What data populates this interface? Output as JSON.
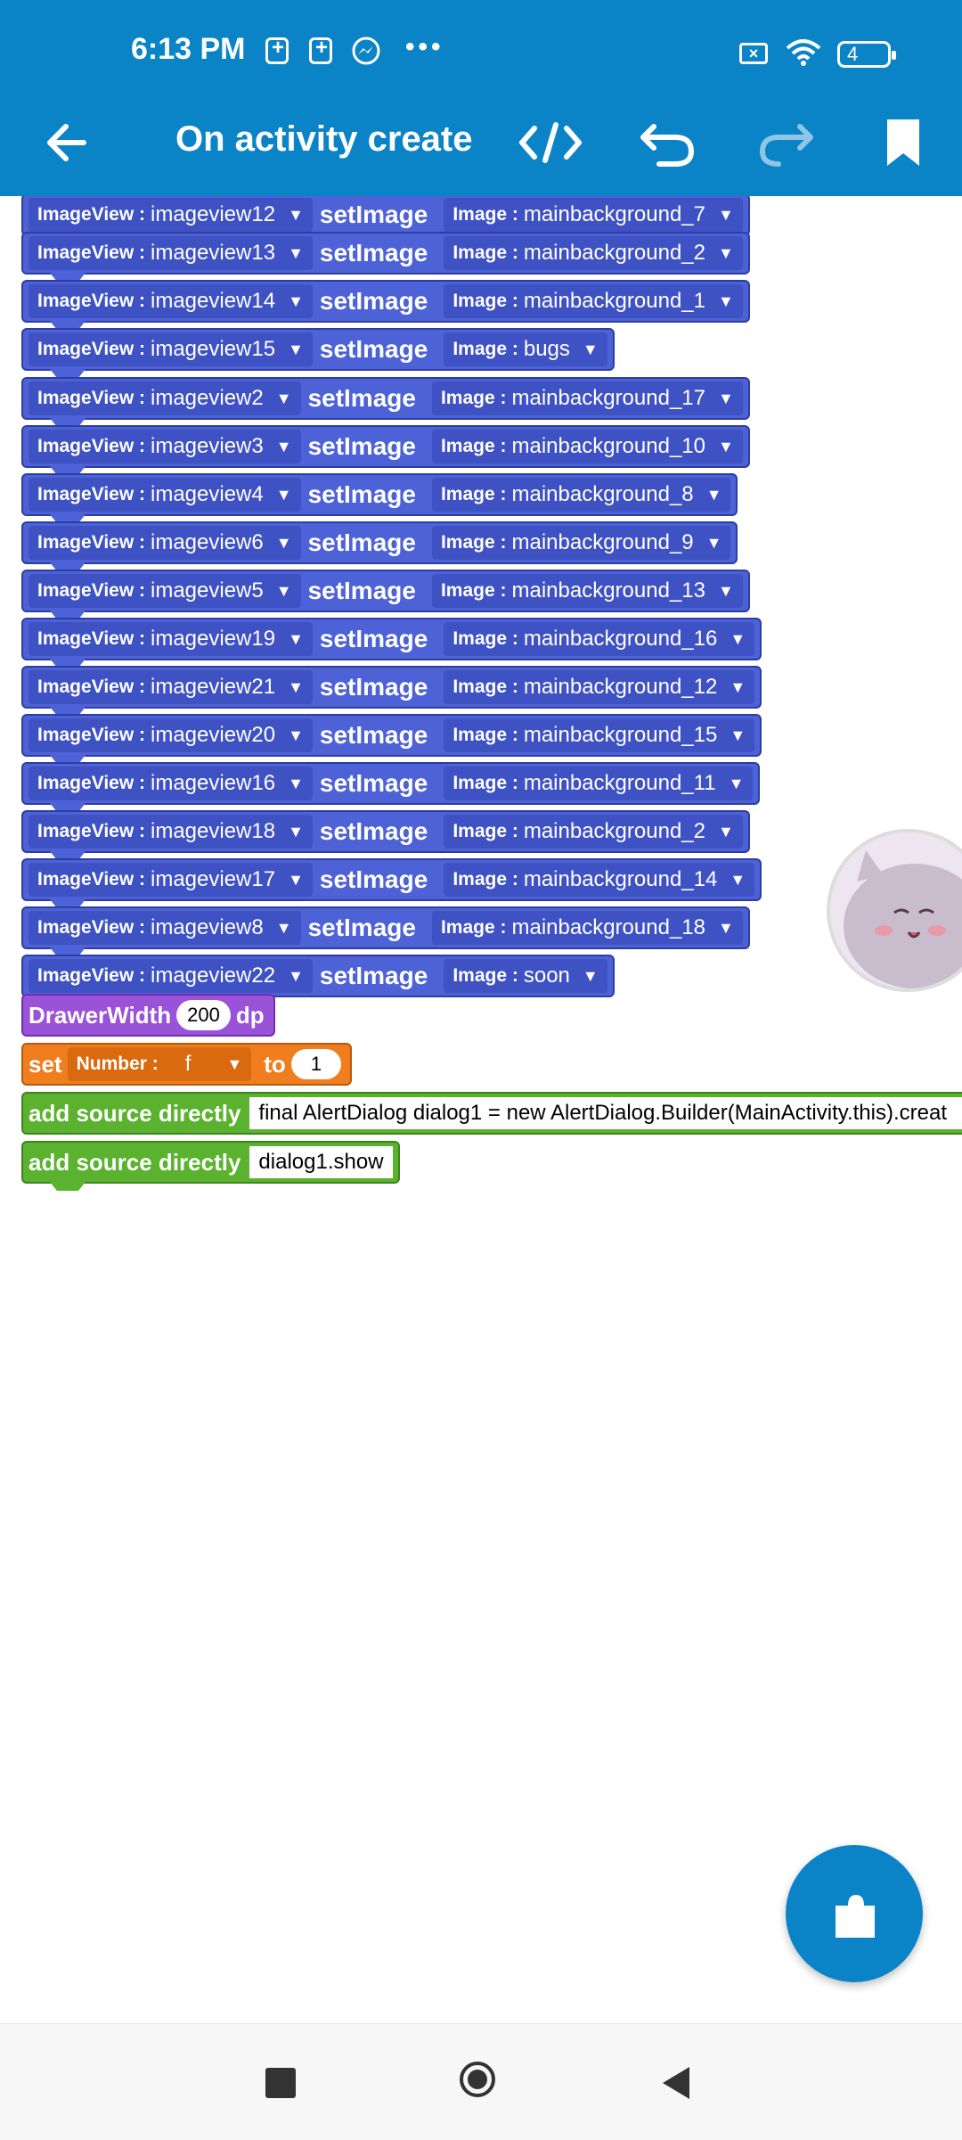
{
  "status_bar": {
    "time": "6:13 PM",
    "battery": "4"
  },
  "app_bar": {
    "title": "On activity create"
  },
  "blocks": [
    {
      "component": "ImageView :",
      "name": "imageview12",
      "method": "setImage",
      "param": "Image :",
      "value": "mainbackground_7"
    },
    {
      "component": "ImageView :",
      "name": "imageview13",
      "method": "setImage",
      "param": "Image :",
      "value": "mainbackground_2"
    },
    {
      "component": "ImageView :",
      "name": "imageview14",
      "method": "setImage",
      "param": "Image :",
      "value": "mainbackground_1"
    },
    {
      "component": "ImageView :",
      "name": "imageview15",
      "method": "setImage",
      "param": "Image :",
      "value": "bugs"
    },
    {
      "component": "ImageView :",
      "name": "imageview2",
      "method": "setImage",
      "param": "Image :",
      "value": "mainbackground_17"
    },
    {
      "component": "ImageView :",
      "name": "imageview3",
      "method": "setImage",
      "param": "Image :",
      "value": "mainbackground_10"
    },
    {
      "component": "ImageView :",
      "name": "imageview4",
      "method": "setImage",
      "param": "Image :",
      "value": "mainbackground_8"
    },
    {
      "component": "ImageView :",
      "name": "imageview6",
      "method": "setImage",
      "param": "Image :",
      "value": "mainbackground_9"
    },
    {
      "component": "ImageView :",
      "name": "imageview5",
      "method": "setImage",
      "param": "Image :",
      "value": "mainbackground_13"
    },
    {
      "component": "ImageView :",
      "name": "imageview19",
      "method": "setImage",
      "param": "Image :",
      "value": "mainbackground_16"
    },
    {
      "component": "ImageView :",
      "name": "imageview21",
      "method": "setImage",
      "param": "Image :",
      "value": "mainbackground_12"
    },
    {
      "component": "ImageView :",
      "name": "imageview20",
      "method": "setImage",
      "param": "Image :",
      "value": "mainbackground_15"
    },
    {
      "component": "ImageView :",
      "name": "imageview16",
      "method": "setImage",
      "param": "Image :",
      "value": "mainbackground_11"
    },
    {
      "component": "ImageView :",
      "name": "imageview18",
      "method": "setImage",
      "param": "Image :",
      "value": "mainbackground_2"
    },
    {
      "component": "ImageView :",
      "name": "imageview17",
      "method": "setImage",
      "param": "Image :",
      "value": "mainbackground_14"
    },
    {
      "component": "ImageView :",
      "name": "imageview8",
      "method": "setImage",
      "param": "Image :",
      "value": "mainbackground_18"
    },
    {
      "component": "ImageView :",
      "name": "imageview22",
      "method": "setImage",
      "param": "Image :",
      "value": "soon"
    }
  ],
  "drawer": {
    "label": "DrawerWidth",
    "value": "200",
    "unit": "dp"
  },
  "set_block": {
    "label": "set",
    "type": "Number :",
    "var": "f",
    "to": "to",
    "value": "1"
  },
  "source_blocks": [
    {
      "label": "add source directly",
      "code": "final AlertDialog dialog1 = new AlertDialog.Builder(MainActivity.this).creat"
    },
    {
      "label": "add source directly",
      "code": "dialog1.show"
    }
  ],
  "icons": {
    "back": "arrow-left-icon",
    "code": "code-icon",
    "undo": "undo-icon",
    "redo": "redo-icon",
    "bookmark": "bookmark-icon",
    "fab": "puzzle-icon",
    "nav_recent": "square-icon",
    "nav_home": "circle-icon",
    "nav_back": "triangle-back-icon"
  },
  "colors": {
    "primary": "#0a84c6",
    "block_blue": "#4d62d6",
    "block_purple": "#9a52d8",
    "block_orange": "#f07e1e",
    "block_green": "#5ab22e"
  }
}
